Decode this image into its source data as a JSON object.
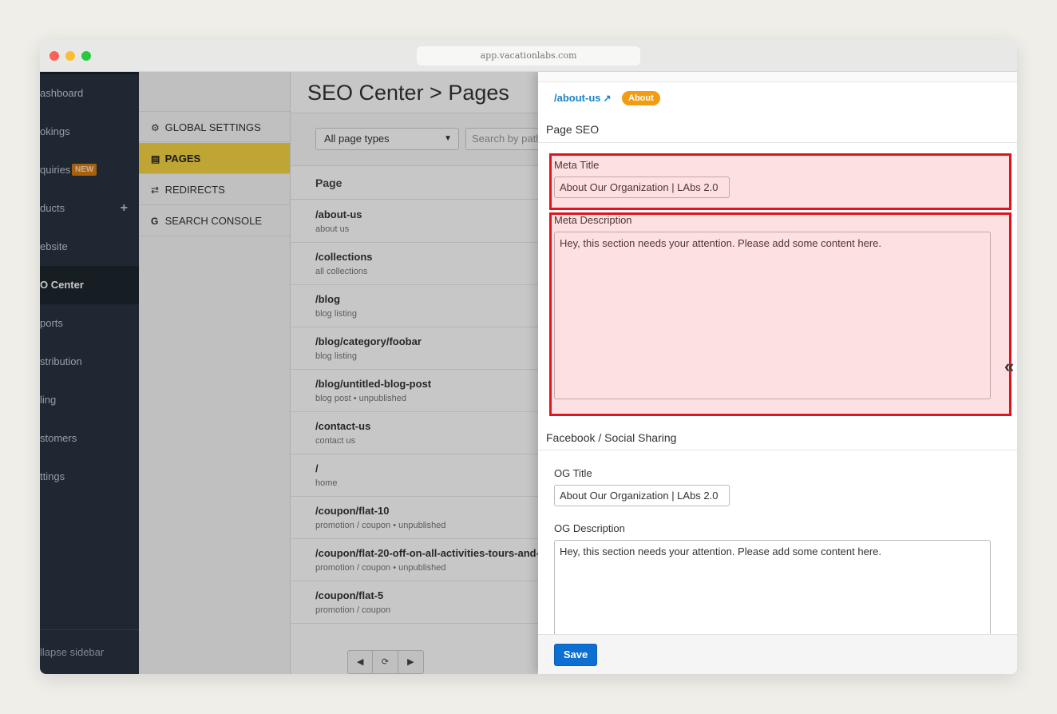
{
  "browser": {
    "url": "app.vacationlabs.com"
  },
  "main_nav": {
    "items": [
      {
        "label": "ashboard",
        "active": false
      },
      {
        "label": "okings",
        "active": false
      },
      {
        "label": "quiries",
        "active": false,
        "badge": "NEW"
      },
      {
        "label": "ducts",
        "active": false,
        "plus": "+"
      },
      {
        "label": "ebsite",
        "active": false
      },
      {
        "label": "O Center",
        "active": true
      },
      {
        "label": "ports",
        "active": false
      },
      {
        "label": "stribution",
        "active": false
      },
      {
        "label": "ling",
        "active": false
      },
      {
        "label": "stomers",
        "active": false
      },
      {
        "label": "ttings",
        "active": false
      }
    ],
    "collapse_label": "llapse sidebar"
  },
  "seo_nav": {
    "items": [
      {
        "icon": "gear-icon",
        "glyph": "⚙",
        "label": "GLOBAL SETTINGS",
        "active": false
      },
      {
        "icon": "file-icon",
        "glyph": "▤",
        "label": "PAGES",
        "active": true
      },
      {
        "icon": "redirect-icon",
        "glyph": "⇄",
        "label": "REDIRECTS",
        "active": false
      },
      {
        "icon": "google-icon",
        "glyph": "G",
        "label": "SEARCH CONSOLE",
        "active": false
      }
    ]
  },
  "main": {
    "title": "SEO Center > Pages",
    "filter_select": "All page types",
    "search_placeholder": "Search by path",
    "column_header": "Page",
    "rows": [
      {
        "path": "/about-us",
        "desc": "about us"
      },
      {
        "path": "/collections",
        "desc": "all collections"
      },
      {
        "path": "/blog",
        "desc": "blog listing"
      },
      {
        "path": "/blog/category/foobar",
        "desc": "blog listing"
      },
      {
        "path": "/blog/untitled-blog-post",
        "desc": "blog post • unpublished"
      },
      {
        "path": "/contact-us",
        "desc": "contact us"
      },
      {
        "path": "/",
        "desc": "home"
      },
      {
        "path": "/coupon/flat-10",
        "desc": "promotion / coupon • unpublished"
      },
      {
        "path": "/coupon/flat-20-off-on-all-activities-tours-and-",
        "desc": "promotion / coupon • unpublished"
      },
      {
        "path": "/coupon/flat-5",
        "desc": "promotion / coupon"
      }
    ],
    "pager": {
      "prev": "◀",
      "refresh": "⟳",
      "next": "▶"
    }
  },
  "drawer": {
    "page_link": "/about-us",
    "page_type_pill": "About",
    "page_seo_heading": "Page SEO",
    "meta_title_label": "Meta Title",
    "meta_title_value": "About Our Organization | LAbs 2.0",
    "meta_desc_label": "Meta Description",
    "meta_desc_value": "Hey, this section needs your attention. Please add some content here.",
    "social_heading": "Facebook / Social Sharing",
    "og_title_label": "OG Title",
    "og_title_value": "About Our Organization | LAbs 2.0",
    "og_desc_label": "OG Description",
    "og_desc_value": "Hey, this section needs your attention. Please add some content here.",
    "collapse_glyph": "«",
    "save_label": "Save"
  },
  "colors": {
    "active_subnav": "#f5d442",
    "link": "#1a83c6",
    "pill": "#f39c12",
    "save_button": "#0d6fd1",
    "highlight_border": "#e0141e"
  }
}
